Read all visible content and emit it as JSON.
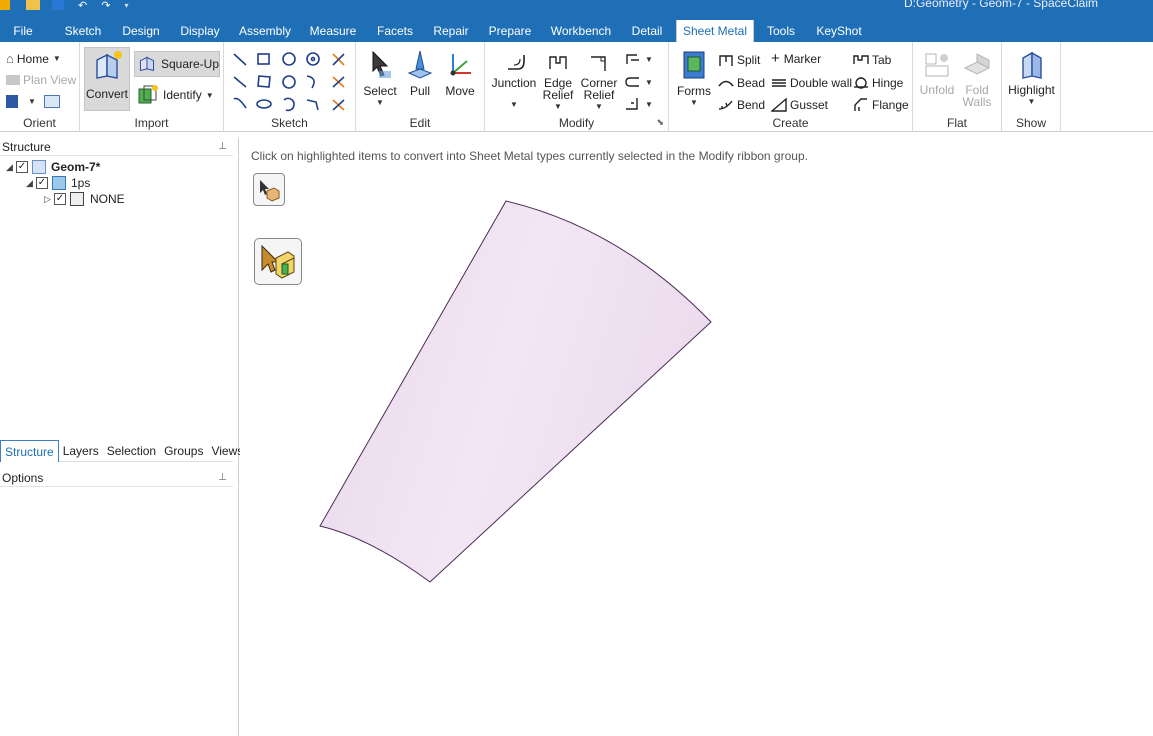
{
  "window": {
    "title": "D:Geometry - Geom-7 - SpaceClaim"
  },
  "menu": {
    "tabs": [
      "File",
      "Sketch",
      "Design",
      "Display",
      "Assembly",
      "Measure",
      "Facets",
      "Repair",
      "Prepare",
      "Workbench",
      "Detail",
      "Sheet Metal",
      "Tools",
      "KeyShot"
    ],
    "active_tab": "Sheet Metal"
  },
  "ribbon": {
    "orient": {
      "label": "Orient",
      "home": "Home",
      "plan_view": "Plan View"
    },
    "import": {
      "label": "Import",
      "convert": "Convert",
      "square_up": "Square-Up",
      "identify": "Identify"
    },
    "sketch": {
      "label": "Sketch"
    },
    "edit": {
      "label": "Edit",
      "select": "Select",
      "pull": "Pull",
      "move": "Move"
    },
    "modify": {
      "label": "Modify",
      "junction": "Junction",
      "edge_relief_1": "Edge",
      "edge_relief_2": "Relief",
      "corner_relief_1": "Corner",
      "corner_relief_2": "Relief"
    },
    "create": {
      "label": "Create",
      "forms": "Forms",
      "split": "Split",
      "bead": "Bead",
      "bend": "Bend",
      "marker": "Marker",
      "double_wall": "Double wall",
      "gusset": "Gusset",
      "tab": "Tab",
      "hinge": "Hinge",
      "flange": "Flange"
    },
    "flat": {
      "label": "Flat",
      "unfold": "Unfold",
      "fold_walls_1": "Fold",
      "fold_walls_2": "Walls"
    },
    "show": {
      "label": "Show",
      "highlight": "Highlight"
    }
  },
  "structure": {
    "header": "Structure",
    "tree": [
      {
        "label": "Geom-7*"
      },
      {
        "label": "1ps"
      },
      {
        "label": "NONE"
      }
    ],
    "tabs": [
      "Structure",
      "Layers",
      "Selection",
      "Groups",
      "Views"
    ],
    "active_tab": "Structure"
  },
  "options": {
    "header": "Options"
  },
  "canvas": {
    "hint": "Click on highlighted items to convert into Sheet Metal types currently selected in the Modify ribbon group.",
    "shape_color": "#eadcec"
  },
  "colors": {
    "accent": "#1e6fb5"
  }
}
